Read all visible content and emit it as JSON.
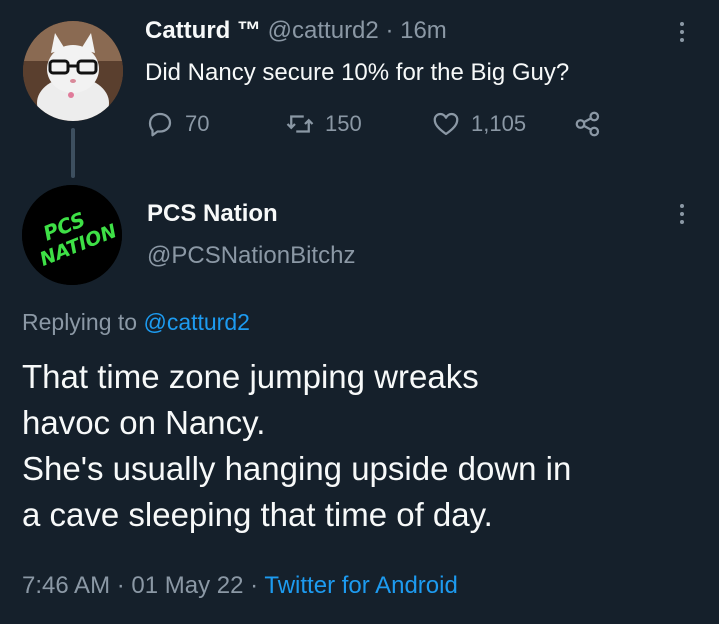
{
  "parent_tweet": {
    "display_name": "Catturd ™",
    "handle": "@catturd2",
    "separator": "·",
    "time_ago": "16m",
    "text": "Did Nancy secure 10% for the Big Guy?",
    "actions": {
      "replies": "70",
      "retweets": "150",
      "likes": "1,105"
    }
  },
  "reply_tweet": {
    "display_name": "PCS Nation",
    "handle": "@PCSNationBitchz",
    "avatar_text": [
      "PCS",
      "NATION"
    ],
    "replying_prefix": "Replying to",
    "replying_to": "@catturd2",
    "text_lines": [
      "That time zone jumping wreaks",
      "havoc on Nancy.",
      "She's usually hanging upside down in",
      "a cave sleeping that time of day."
    ],
    "time": "7:46 AM",
    "date": "01 May 22",
    "separator": "·",
    "source": "Twitter for Android"
  },
  "colors": {
    "background": "#15202b",
    "text": "#f7f9f9",
    "muted": "#8b98a5",
    "link": "#1d9bf0",
    "avatar_text": "#3ee046"
  },
  "icons": {
    "reply": "reply-bubble-icon",
    "retweet": "retweet-icon",
    "like": "heart-icon",
    "share": "share-icon",
    "more": "more-vertical-icon"
  }
}
